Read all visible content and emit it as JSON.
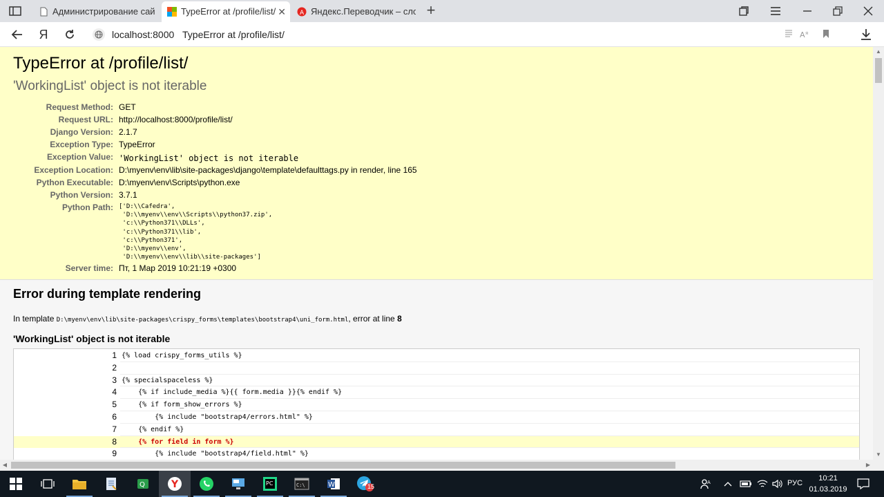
{
  "browser": {
    "tabs": [
      {
        "label": "Администрирование сайта",
        "active": false,
        "icon": "document-icon"
      },
      {
        "label": "TypeError at /profile/list/",
        "active": true,
        "icon": "django-page-icon"
      },
      {
        "label": "Яндекс.Переводчик – словарь",
        "active": false,
        "icon": "yandex-translate-icon"
      }
    ],
    "new_tab": "+",
    "address": {
      "host": "localhost:8000",
      "title": "TypeError at /profile/list/"
    },
    "yandex_logo": "Я"
  },
  "error_summary": {
    "title": "TypeError at /profile/list/",
    "subtitle": "'WorkingList' object is not iterable",
    "rows": [
      {
        "label": "Request Method:",
        "value": "GET"
      },
      {
        "label": "Request URL:",
        "value": "http://localhost:8000/profile/list/"
      },
      {
        "label": "Django Version:",
        "value": "2.1.7"
      },
      {
        "label": "Exception Type:",
        "value": "TypeError"
      },
      {
        "label": "Exception Value:",
        "value": "'WorkingList' object is not iterable"
      },
      {
        "label": "Exception Location:",
        "value": "D:\\myenv\\env\\lib\\site-packages\\django\\template\\defaulttags.py in render, line 165"
      },
      {
        "label": "Python Executable:",
        "value": "D:\\myenv\\env\\Scripts\\python.exe"
      },
      {
        "label": "Python Version:",
        "value": "3.7.1"
      },
      {
        "label": "Python Path:",
        "value": "['D:\\\\Cafedra',\n 'D:\\\\myenv\\\\env\\\\Scripts\\\\python37.zip',\n 'c:\\\\Python371\\\\DLLs',\n 'c:\\\\Python371\\\\lib',\n 'c:\\\\Python371',\n 'D:\\\\myenv\\\\env',\n 'D:\\\\myenv\\\\env\\\\lib\\\\site-packages']"
      },
      {
        "label": "Server time:",
        "value": "Пт, 1 Мар 2019 10:21:19 +0300"
      }
    ]
  },
  "template_error": {
    "heading": "Error during template rendering",
    "intro_prefix": "In template",
    "template_path": "D:\\myenv\\env\\lib\\site-packages\\crispy_forms\\templates\\bootstrap4\\uni_form.html",
    "intro_suffix": ", error at line",
    "error_line": "8",
    "message": "'WorkingList' object is not iterable",
    "source_lines": [
      {
        "num": "1",
        "code": "{% load crispy_forms_utils %}",
        "error": false
      },
      {
        "num": "2",
        "code": "",
        "error": false
      },
      {
        "num": "3",
        "code": "{% specialspaceless %}",
        "error": false
      },
      {
        "num": "4",
        "code": "    {% if include_media %}{{ form.media }}{% endif %}",
        "error": false
      },
      {
        "num": "5",
        "code": "    {% if form_show_errors %}",
        "error": false
      },
      {
        "num": "6",
        "code": "        {% include \"bootstrap4/errors.html\" %}",
        "error": false
      },
      {
        "num": "7",
        "code": "    {% endif %}",
        "error": false
      },
      {
        "num": "8",
        "code": "    {% for field in form %}",
        "error": true
      },
      {
        "num": "9",
        "code": "        {% include \"bootstrap4/field.html\" %}",
        "error": false
      }
    ]
  },
  "taskbar": {
    "apps": [
      "windows-start-icon",
      "task-view-icon",
      "file-explorer-icon",
      "notepad-icon",
      "excel-like-icon",
      "yandex-browser-icon",
      "whatsapp-icon",
      "monitor-icon",
      "pycharm-icon",
      "terminal-icon",
      "word-icon",
      "telegram-icon"
    ],
    "telegram_badge": "15",
    "language": "РУС",
    "time": "10:21",
    "date": "01.03.2019"
  },
  "colors": {
    "summary_bg": "#ffffc8",
    "error_text": "#cc0000",
    "taskbar_bg": "#101820"
  }
}
